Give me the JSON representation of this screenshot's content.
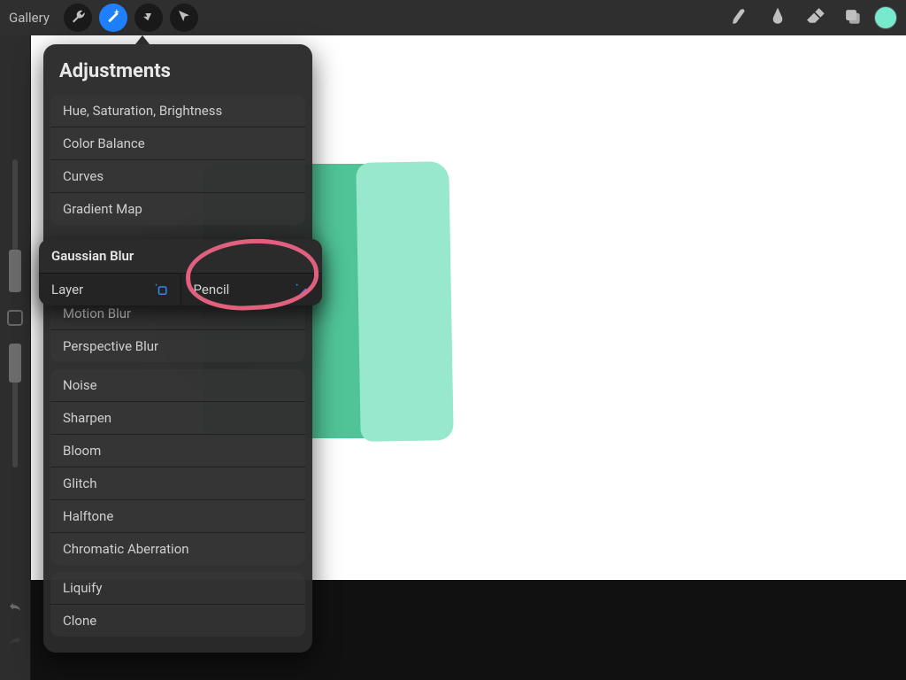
{
  "app": {
    "gallery_label": "Gallery"
  },
  "colors": {
    "accent": "#1f80ff",
    "swatch": "#77e9cd",
    "annotation": "#e0607e"
  },
  "topbar_tools": {
    "wrench": "settings-tool",
    "wand": "adjustments-tool",
    "select": "selection-tool",
    "move": "transform-tool",
    "brush": "brush-tool",
    "smudge": "smudge-tool",
    "erase": "eraser-tool",
    "layers": "layers-tool"
  },
  "panel": {
    "title": "Adjustments",
    "groups": [
      {
        "items": [
          "Hue, Saturation, Brightness",
          "Color Balance",
          "Curves",
          "Gradient Map"
        ]
      },
      {
        "items": [
          "Motion Blur",
          "Perspective Blur"
        ]
      },
      {
        "items": [
          "Noise",
          "Sharpen",
          "Bloom",
          "Glitch",
          "Halftone",
          "Chromatic Aberration"
        ]
      },
      {
        "items": [
          "Liquify",
          "Clone"
        ]
      }
    ]
  },
  "flyout": {
    "title": "Gaussian Blur",
    "options": [
      {
        "label": "Layer",
        "icon": "sparkle-layer-icon"
      },
      {
        "label": "Pencil",
        "icon": "sparkle-pencil-icon"
      }
    ]
  }
}
